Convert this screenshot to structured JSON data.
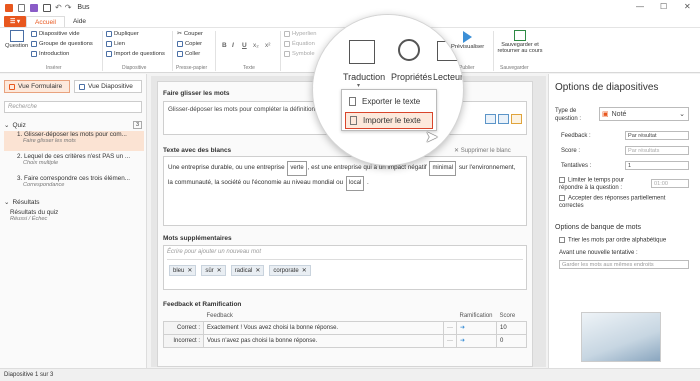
{
  "window": {
    "title": "Bus",
    "controls": {
      "min": "—",
      "max": "☐",
      "close": "✕"
    }
  },
  "ribbon": {
    "file_label": "",
    "tabs": [
      "Accueil",
      "Aide"
    ],
    "insert": {
      "question_label": "Question",
      "items": [
        "Diapositive vide",
        "Groupe de questions",
        "Introduction"
      ],
      "group": "Insérer"
    },
    "slide": {
      "items": [
        "Dupliquer",
        "Lien",
        "Import de questions"
      ],
      "group": "Diapositive"
    },
    "clipboard": {
      "items": [
        "Couper",
        "Copier",
        "Coller"
      ],
      "group": "Presse-papier"
    },
    "text": {
      "group": "Texte",
      "format": [
        "B",
        "I",
        "U",
        "x₂",
        "x²"
      ]
    },
    "insert2": {
      "items": [
        "Hyperlien",
        "Équation",
        "Symbole"
      ]
    },
    "publish": {
      "label": "Prévisualiser",
      "group": "Publier"
    },
    "save": {
      "label": "Sauvegarder et retourner au cours",
      "group": "Sauvegarder"
    }
  },
  "magnifier": {
    "items": [
      "Traduction",
      "Propriétés",
      "Lecteur"
    ],
    "menu": [
      "Exporter le texte",
      "Importer le texte"
    ]
  },
  "left": {
    "views": [
      "Vue Formulaire",
      "Vue Diapositive"
    ],
    "search_placeholder": "Recherche",
    "quiz_label": "Quiz",
    "quiz_count": "3",
    "questions": [
      {
        "title": "1. Glisser-déposer les mots pour com...",
        "subtitle": "Faire glisser les mots"
      },
      {
        "title": "2. Lequel de ces critères n'est PAS un ...",
        "subtitle": "Choix multiple"
      },
      {
        "title": "3. Faire correspondre ces trois élémen...",
        "subtitle": "Correspondance"
      }
    ],
    "results_label": "Résultats",
    "results_item": {
      "title": "Résultats du quiz",
      "subtitle": "Réussi / Échec"
    }
  },
  "main": {
    "q_title": "Faire glisser les mots",
    "q_text": "Glisser-déposer les mots pour compléter la définition",
    "blanks_title": "Texte avec des blancs",
    "delete_blank": "Supprimer le blanc",
    "sentence": {
      "p1": "Une entreprise durable, ou une entreprise",
      "g1": "verte",
      "p2": ", est une entreprise qui a un impact négatif",
      "g2": "minimal",
      "p3": "sur",
      "p4": "l'environnement, la communauté, la société ou l'économie au niveau mondial ou",
      "g3": "local",
      "p5": "."
    },
    "extra_title": "Mots supplémentaires",
    "extra_placeholder": "Écrire pour ajouter un nouveau mot",
    "tags": [
      "bleu",
      "sûr",
      "radical",
      "corporate"
    ],
    "fb_title": "Feedback et Ramification",
    "fb_headers": [
      "Feedback",
      "Ramification",
      "Score"
    ],
    "fb_rows": [
      {
        "label": "Correct :",
        "text": "Exactement ! Vous avez choisi la bonne réponse.",
        "score": "10"
      },
      {
        "label": "Incorrect :",
        "text": "Vous n'avez pas choisi la bonne réponse.",
        "score": "0"
      }
    ]
  },
  "right": {
    "title": "Options de diapositives",
    "qtype_label": "Type de question :",
    "qtype_value": "Noté",
    "feedback_label": "Feedback :",
    "feedback_value": "Par résultat",
    "score_label": "Score :",
    "score_value": "Par résultats",
    "attempts_label": "Tentatives :",
    "attempts_value": "1",
    "limit_label": "Limiter le temps pour répondre à la question :",
    "limit_value": "01:00",
    "partial_label": "Accepter des réponses partiellement correctes",
    "bank_title": "Options de banque de mots",
    "sort_label": "Trier les mots par ordre alphabétique",
    "before_label": "Avant une nouvelle tentative :",
    "before_value": "Garder les mots aux mêmes endroits"
  },
  "status": "Diapositive 1 sur 3"
}
